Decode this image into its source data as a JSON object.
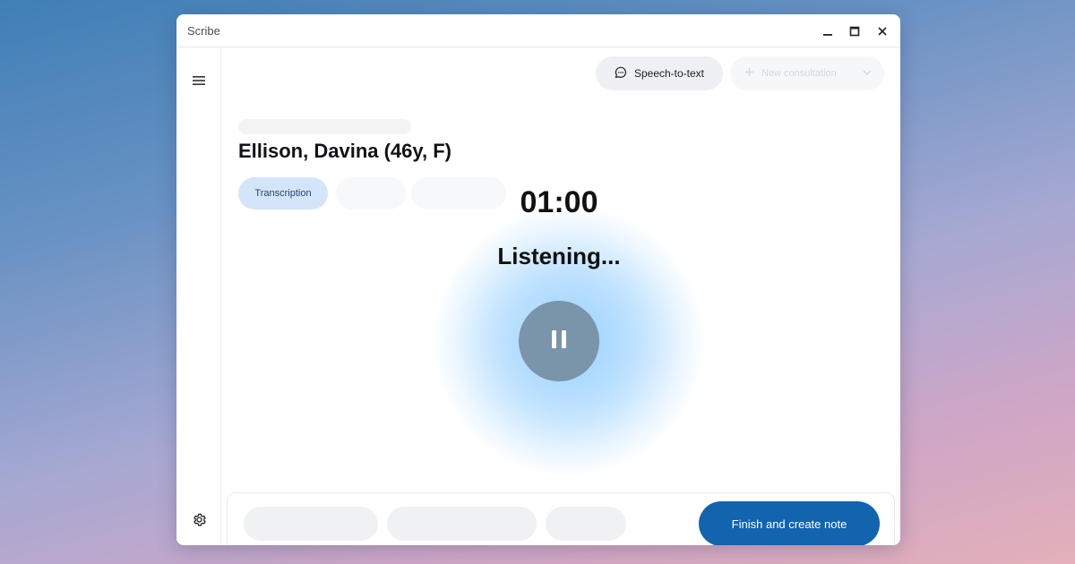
{
  "window": {
    "title": "Scribe",
    "controls": [
      "minimize-icon",
      "maximize-icon",
      "close-icon"
    ]
  },
  "sidebar": {
    "menu_icon": "hamburger-menu-icon",
    "settings_icon": "gear-icon"
  },
  "header": {
    "speech_to_text_label": "Speech-to-text",
    "speech_to_text_icon": "chat-bubble-icon",
    "new_consultation_label": "New consultation",
    "new_consultation_icon": "plus-icon",
    "new_consultation_dropdown_icon": "chevron-down-icon"
  },
  "patient": {
    "name": "Ellison, Davina (46y, F)"
  },
  "tabs": [
    {
      "label": "Transcription",
      "selected": true
    }
  ],
  "recording": {
    "timer": "01:00",
    "status": "Listening...",
    "pause_icon": "pause-icon"
  },
  "footer": {
    "finish_label": "Finish and create note"
  },
  "colors": {
    "accent": "#1164ad",
    "tab_selected_bg": "#d5e5f9",
    "pause_button": "#7a94aa",
    "glow": "#8fcdff"
  }
}
